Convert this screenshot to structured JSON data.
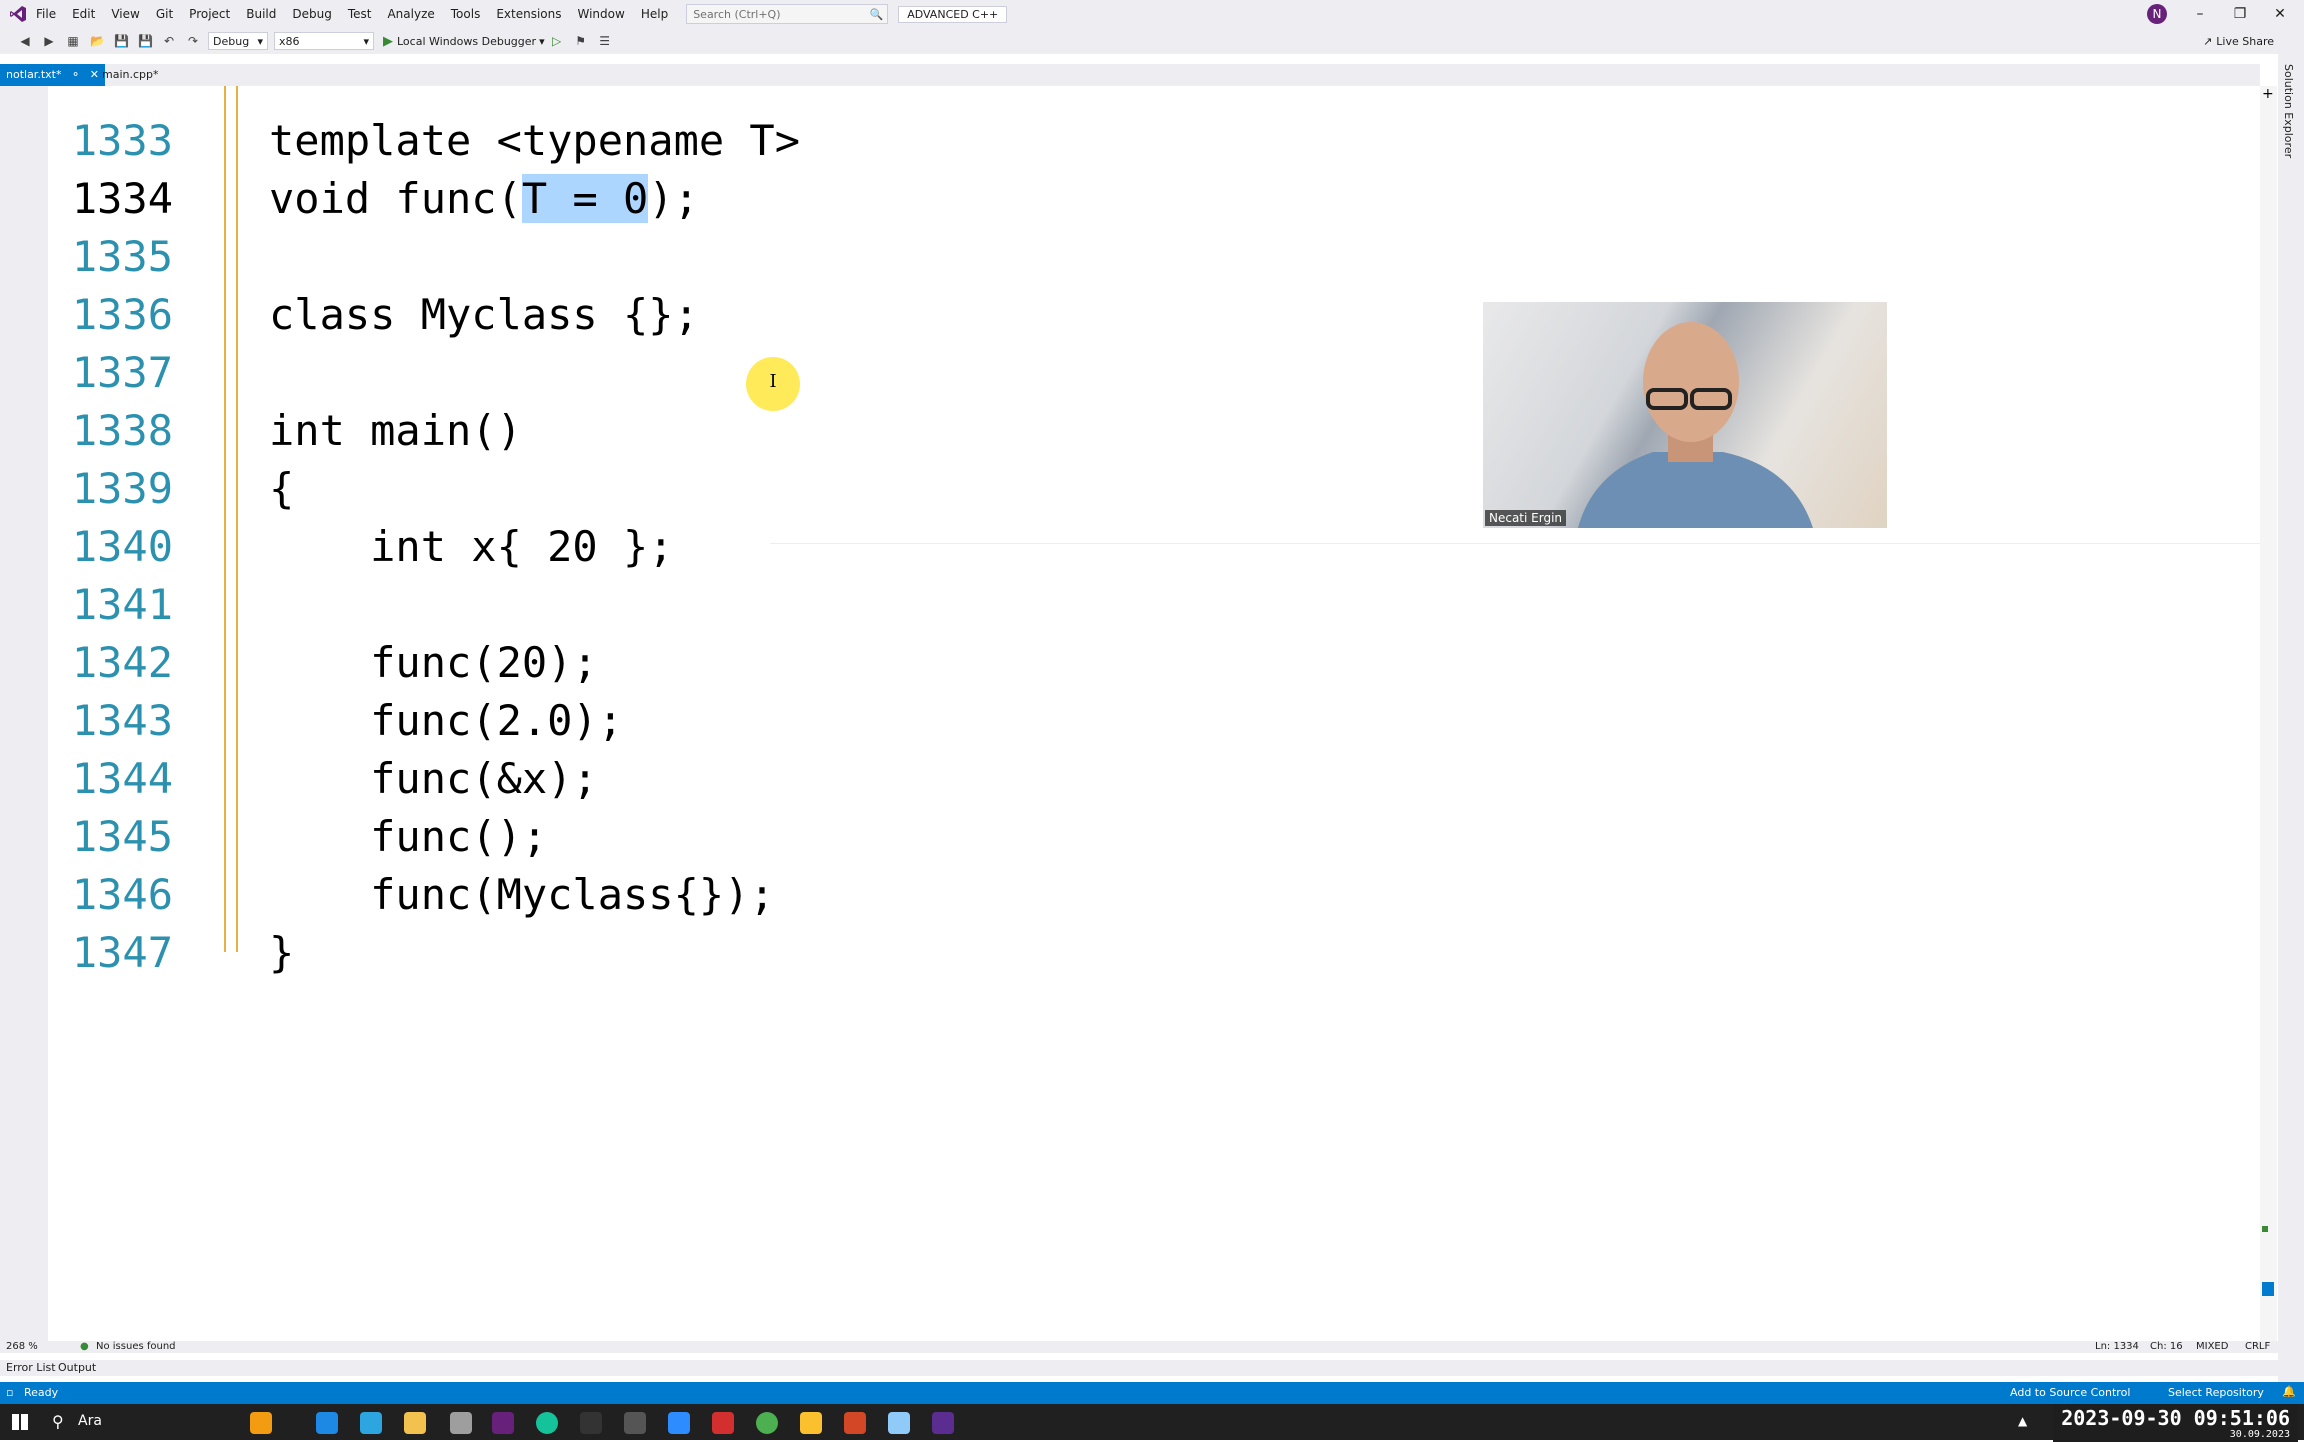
{
  "menu": [
    "File",
    "Edit",
    "View",
    "Git",
    "Project",
    "Build",
    "Debug",
    "Test",
    "Analyze",
    "Tools",
    "Extensions",
    "Window",
    "Help"
  ],
  "search": {
    "placeholder": "Search (Ctrl+Q)"
  },
  "solution_title": "ADVANCED C++",
  "user_initial": "N",
  "toolbar": {
    "config": "Debug",
    "platform": "x86",
    "debugger_label": "Local Windows Debugger",
    "live_share": "Live Share"
  },
  "tabs": [
    {
      "label": "notlar.txt*"
    },
    {
      "label": "main.cpp*"
    }
  ],
  "editor": {
    "lines": [
      {
        "num": "1333",
        "code": "template <typename T>"
      },
      {
        "num": "1334",
        "code_before": "void func(",
        "code_selected": "T = 0",
        "code_after": ");"
      },
      {
        "num": "1335",
        "code": ""
      },
      {
        "num": "1336",
        "code": "class Myclass {};"
      },
      {
        "num": "1337",
        "code": ""
      },
      {
        "num": "1338",
        "code": "int main()"
      },
      {
        "num": "1339",
        "code": "{"
      },
      {
        "num": "1340",
        "code": "    int x{ 20 };"
      },
      {
        "num": "1341",
        "code": ""
      },
      {
        "num": "1342",
        "code": "    func(20);"
      },
      {
        "num": "1343",
        "code": "    func(2.0);"
      },
      {
        "num": "1344",
        "code": "    func(&x);"
      },
      {
        "num": "1345",
        "code": "    func();"
      },
      {
        "num": "1346",
        "code": "    func(Myclass{});"
      },
      {
        "num": "1347",
        "code": "}"
      }
    ]
  },
  "webcam": {
    "name": "Necati Ergin"
  },
  "side_panel": {
    "label": "Solution Explorer"
  },
  "editor_status": {
    "zoom": "268 %",
    "issues": "No issues found",
    "line": "Ln: 1334",
    "col": "Ch: 16",
    "tabs": "MIXED",
    "eol": "CRLF"
  },
  "bottom_tabs": [
    "Error List",
    "Output"
  ],
  "statusbar": {
    "ready": "Ready",
    "source_control": "Add to Source Control",
    "repository": "Select Repository"
  },
  "taskbar": {
    "search_text": "Ara",
    "clock": "2023-09-30 09:51:06",
    "date": "30.09.2023"
  }
}
